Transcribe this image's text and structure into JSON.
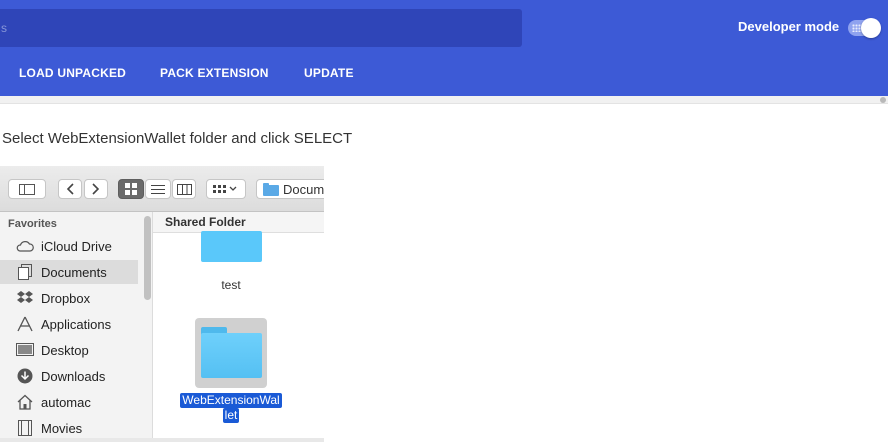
{
  "header": {
    "search_hint": "s",
    "developer_mode_label": "Developer mode",
    "developer_mode_on": true
  },
  "toolbar": {
    "load_unpacked": "LOAD UNPACKED",
    "pack_extension": "PACK EXTENSION",
    "update": "UPDATE"
  },
  "instruction": "Select WebExtensionWallet folder and click SELECT",
  "finder": {
    "path_label": "Docum",
    "favorites_heading": "Favorites",
    "sidebar_items": [
      {
        "label": "iCloud Drive",
        "icon": "cloud-icon"
      },
      {
        "label": "Documents",
        "icon": "document-icon",
        "selected": true
      },
      {
        "label": "Dropbox",
        "icon": "dropbox-icon"
      },
      {
        "label": "Applications",
        "icon": "applications-icon"
      },
      {
        "label": "Desktop",
        "icon": "desktop-icon"
      },
      {
        "label": "Downloads",
        "icon": "download-icon"
      },
      {
        "label": "automac",
        "icon": "home-icon"
      },
      {
        "label": "Movies",
        "icon": "movie-icon"
      }
    ],
    "content_header": "Shared Folder",
    "folders": [
      {
        "label": "test"
      },
      {
        "label_line1": "WebExtensionWal",
        "label_line2": "let",
        "selected": true
      }
    ],
    "colors": {
      "folder": "#5ac8fa",
      "selection": "#1a5ad6",
      "header": "#3d5ad6"
    }
  }
}
